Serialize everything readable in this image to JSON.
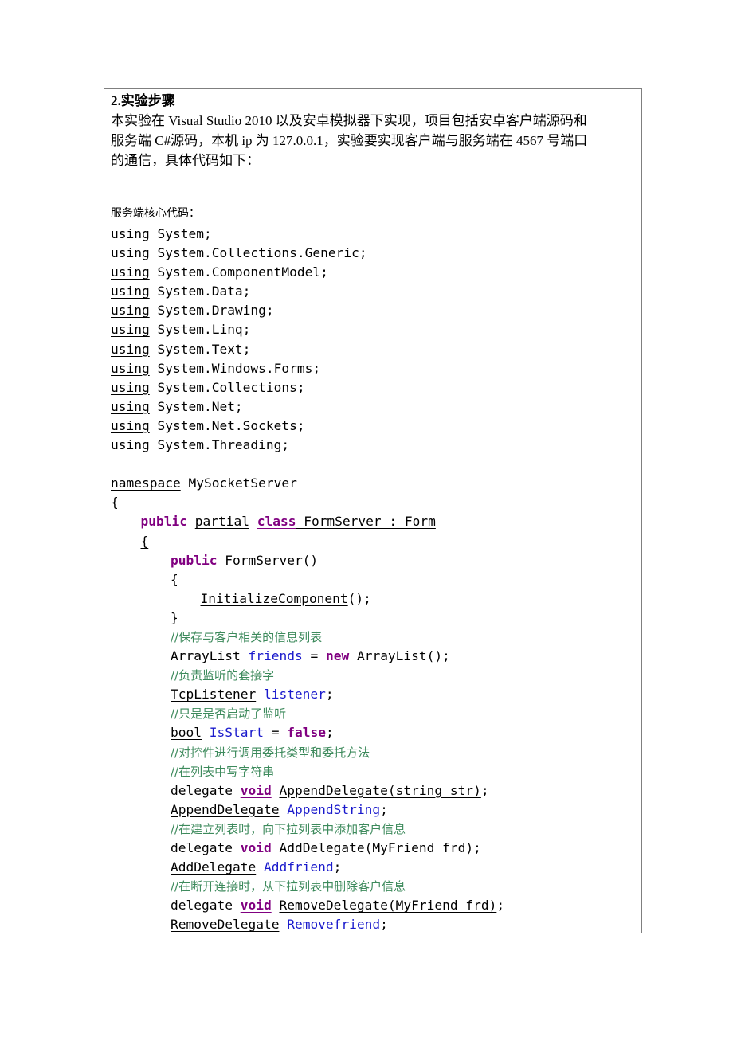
{
  "section": {
    "heading": "2.实验步骤",
    "paragraph_lines": [
      "本实验在 Visual Studio 2010 以及安卓模拟器下实现，项目包括安卓客户端源码和",
      "服务端 C#源码，本机 ip 为 127.0.0.1，实验要实现客户端与服务端在 4567 号端口",
      "的通信，具体代码如下："
    ],
    "code_heading": "服务端核心代码："
  },
  "code": [
    {
      "indent": 0,
      "tokens": [
        {
          "t": "using",
          "c": "u"
        },
        {
          "t": " System;"
        }
      ]
    },
    {
      "indent": 0,
      "tokens": [
        {
          "t": "using",
          "c": "u"
        },
        {
          "t": " System.Collections.Generic;"
        }
      ]
    },
    {
      "indent": 0,
      "tokens": [
        {
          "t": "using",
          "c": "u"
        },
        {
          "t": " System.ComponentModel;"
        }
      ]
    },
    {
      "indent": 0,
      "tokens": [
        {
          "t": "using",
          "c": "u"
        },
        {
          "t": " System.Data;"
        }
      ]
    },
    {
      "indent": 0,
      "tokens": [
        {
          "t": "using",
          "c": "u"
        },
        {
          "t": " System.Drawing;"
        }
      ]
    },
    {
      "indent": 0,
      "tokens": [
        {
          "t": "using",
          "c": "u"
        },
        {
          "t": " System.Linq;"
        }
      ]
    },
    {
      "indent": 0,
      "tokens": [
        {
          "t": "using",
          "c": "u"
        },
        {
          "t": " System.Text;"
        }
      ]
    },
    {
      "indent": 0,
      "tokens": [
        {
          "t": "using",
          "c": "u"
        },
        {
          "t": " System.Windows.Forms;"
        }
      ]
    },
    {
      "indent": 0,
      "tokens": [
        {
          "t": "using",
          "c": "u"
        },
        {
          "t": " System.Collections;"
        }
      ]
    },
    {
      "indent": 0,
      "tokens": [
        {
          "t": "using",
          "c": "u"
        },
        {
          "t": " System.Net;"
        }
      ]
    },
    {
      "indent": 0,
      "tokens": [
        {
          "t": "using",
          "c": "u"
        },
        {
          "t": " System.Net.Sockets;"
        }
      ]
    },
    {
      "indent": 0,
      "tokens": [
        {
          "t": "using",
          "c": "u"
        },
        {
          "t": " System.Threading;"
        }
      ]
    },
    {
      "indent": 0,
      "tokens": []
    },
    {
      "indent": 0,
      "tokens": [
        {
          "t": "namespace",
          "c": "u"
        },
        {
          "t": " MySocketServer"
        }
      ]
    },
    {
      "indent": 0,
      "tokens": [
        {
          "t": "{"
        }
      ]
    },
    {
      "indent": 1,
      "tokens": [
        {
          "t": "public",
          "c": "kw"
        },
        {
          "t": " "
        },
        {
          "t": "partial",
          "c": "u"
        },
        {
          "t": " "
        },
        {
          "t": "class",
          "c": "kw u"
        },
        {
          "t": " FormServer : Form",
          "c": "u"
        }
      ]
    },
    {
      "indent": 1,
      "tokens": [
        {
          "t": "{",
          "c": "u"
        }
      ]
    },
    {
      "indent": 2,
      "tokens": [
        {
          "t": "public",
          "c": "kw"
        },
        {
          "t": " FormServer()"
        }
      ]
    },
    {
      "indent": 2,
      "tokens": [
        {
          "t": "{"
        }
      ]
    },
    {
      "indent": 3,
      "tokens": [
        {
          "t": "InitializeComponent",
          "c": "u"
        },
        {
          "t": "();"
        }
      ]
    },
    {
      "indent": 2,
      "tokens": [
        {
          "t": "}"
        }
      ]
    },
    {
      "indent": 2,
      "tokens": [
        {
          "t": "//保存与客户相关的信息列表",
          "c": "cm"
        }
      ]
    },
    {
      "indent": 2,
      "tokens": [
        {
          "t": "ArrayList",
          "c": "u"
        },
        {
          "t": " "
        },
        {
          "t": "friends",
          "c": "id"
        },
        {
          "t": " = "
        },
        {
          "t": "new",
          "c": "kw"
        },
        {
          "t": " "
        },
        {
          "t": "ArrayList",
          "c": "u"
        },
        {
          "t": "();"
        }
      ]
    },
    {
      "indent": 2,
      "tokens": [
        {
          "t": "//负责监听的套接字",
          "c": "cm"
        }
      ]
    },
    {
      "indent": 2,
      "tokens": [
        {
          "t": "TcpListener",
          "c": "u"
        },
        {
          "t": " "
        },
        {
          "t": "listener",
          "c": "id"
        },
        {
          "t": ";"
        }
      ]
    },
    {
      "indent": 2,
      "tokens": [
        {
          "t": "//只是是否启动了监听",
          "c": "cm"
        }
      ]
    },
    {
      "indent": 2,
      "tokens": [
        {
          "t": "bool",
          "c": "u"
        },
        {
          "t": " "
        },
        {
          "t": "IsStart",
          "c": "id"
        },
        {
          "t": " = "
        },
        {
          "t": "false",
          "c": "kw"
        },
        {
          "t": ";"
        }
      ]
    },
    {
      "indent": 2,
      "tokens": [
        {
          "t": "//对控件进行调用委托类型和委托方法",
          "c": "cm"
        }
      ]
    },
    {
      "indent": 2,
      "tokens": [
        {
          "t": "//在列表中写字符串",
          "c": "cm"
        }
      ]
    },
    {
      "indent": 2,
      "tokens": [
        {
          "t": "delegate "
        },
        {
          "t": "void",
          "c": "kw u"
        },
        {
          "t": " "
        },
        {
          "t": "AppendDelegate(string str)",
          "c": "u"
        },
        {
          "t": ";"
        }
      ]
    },
    {
      "indent": 2,
      "tokens": [
        {
          "t": "AppendDelegate",
          "c": "u"
        },
        {
          "t": " "
        },
        {
          "t": "AppendString",
          "c": "id"
        },
        {
          "t": ";"
        }
      ]
    },
    {
      "indent": 2,
      "tokens": [
        {
          "t": "//在建立列表时，向下拉列表中添加客户信息",
          "c": "cm"
        }
      ]
    },
    {
      "indent": 2,
      "tokens": [
        {
          "t": "delegate "
        },
        {
          "t": "void",
          "c": "kw u"
        },
        {
          "t": " "
        },
        {
          "t": "AddDelegate(MyFriend frd)",
          "c": "u"
        },
        {
          "t": ";"
        }
      ]
    },
    {
      "indent": 2,
      "tokens": [
        {
          "t": "AddDelegate",
          "c": "u"
        },
        {
          "t": " "
        },
        {
          "t": "Addfriend",
          "c": "id"
        },
        {
          "t": ";"
        }
      ]
    },
    {
      "indent": 2,
      "tokens": [
        {
          "t": "//在断开连接时，从下拉列表中删除客户信息",
          "c": "cm"
        }
      ]
    },
    {
      "indent": 2,
      "tokens": [
        {
          "t": "delegate "
        },
        {
          "t": "void",
          "c": "kw u"
        },
        {
          "t": " "
        },
        {
          "t": "RemoveDelegate(MyFriend frd)",
          "c": "u"
        },
        {
          "t": ";"
        }
      ]
    },
    {
      "indent": 2,
      "tokens": [
        {
          "t": "RemoveDelegate",
          "c": "u"
        },
        {
          "t": " "
        },
        {
          "t": "Removefriend",
          "c": "id"
        },
        {
          "t": ";"
        }
      ]
    }
  ],
  "colors": {
    "keyword": "#800080",
    "identifier": "#1a1acc",
    "comment": "#3d8a5c",
    "border": "#7f7f7f"
  }
}
